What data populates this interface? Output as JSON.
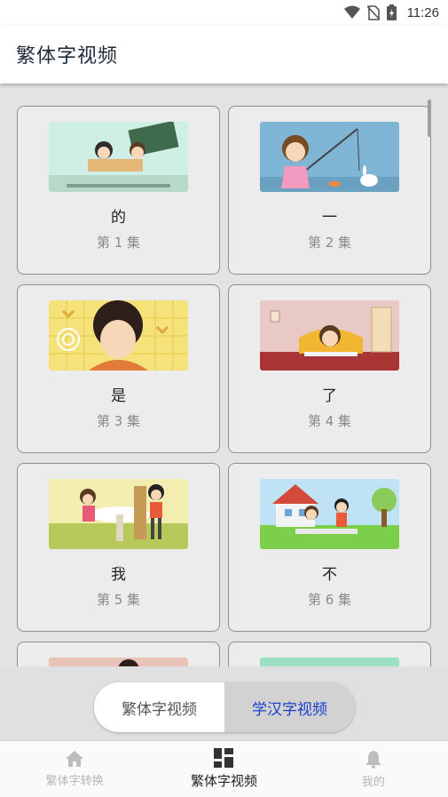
{
  "status_bar": {
    "time": "11:26",
    "icons": [
      "wifi-icon",
      "no-sim-icon",
      "battery-charging-icon"
    ]
  },
  "app_bar": {
    "title": "繁体字视频"
  },
  "videos": [
    {
      "char": "的",
      "episode": "第 1 集"
    },
    {
      "char": "一",
      "episode": "第 2 集"
    },
    {
      "char": "是",
      "episode": "第 3 集"
    },
    {
      "char": "了",
      "episode": "第 4 集"
    },
    {
      "char": "我",
      "episode": "第 5 集"
    },
    {
      "char": "不",
      "episode": "第 6 集"
    },
    {
      "char": "",
      "episode": ""
    },
    {
      "char": "",
      "episode": ""
    }
  ],
  "segment": {
    "options": [
      "繁体字视频",
      "学汉字视频"
    ],
    "selected": 1
  },
  "bottom_nav": {
    "items": [
      {
        "label": "繁体字转换",
        "icon": "home-icon"
      },
      {
        "label": "繁体字视频",
        "icon": "grid-icon"
      },
      {
        "label": "我的",
        "icon": "bell-icon"
      }
    ],
    "selected": 1
  },
  "colors": {
    "accent": "#1a3dcc",
    "app_bar_bg": "#ffffff",
    "content_bg": "#e3e3e3"
  }
}
